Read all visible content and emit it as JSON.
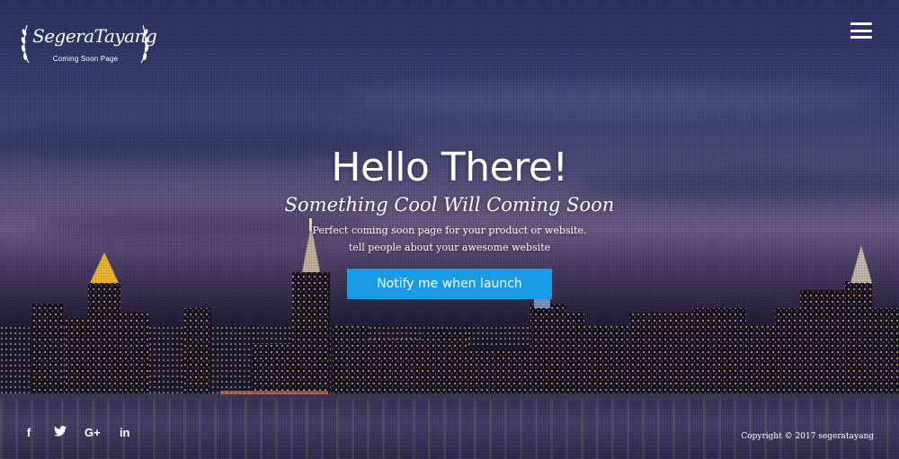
{
  "brand": {
    "name": "SegeraTayang",
    "tagline": "Coming Soon Page"
  },
  "nav": {
    "menu_icon": "hamburger-menu-icon"
  },
  "hero": {
    "title": "Hello There!",
    "subtitle": "Something Cool Will Coming Soon",
    "line1": "Perfect coming soon page for your product or website.",
    "line2": "tell people about your awesome website",
    "button_label": "Notify me when launch"
  },
  "footer": {
    "social": [
      {
        "icon": "facebook-icon",
        "glyph": "f"
      },
      {
        "icon": "twitter-icon",
        "glyph": "🐦"
      },
      {
        "icon": "google-plus-icon",
        "glyph": "G+"
      },
      {
        "icon": "linkedin-icon",
        "glyph": "in"
      }
    ],
    "copyright": "Copyright © 2017 segeratayang"
  },
  "colors": {
    "accent": "#1a9be6",
    "text": "#ffffff"
  }
}
